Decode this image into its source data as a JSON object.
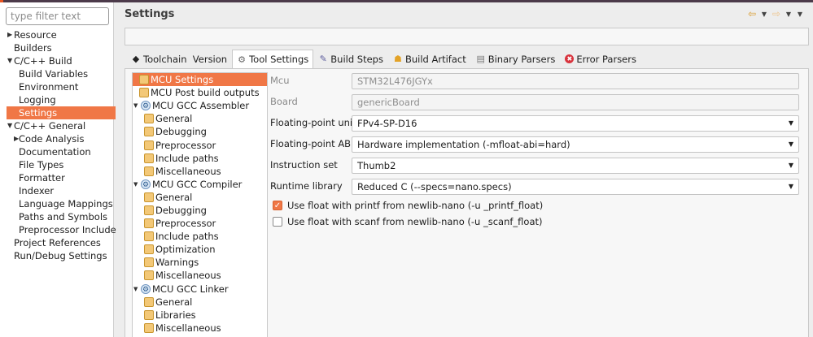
{
  "filter": {
    "placeholder": "type filter text"
  },
  "nav": {
    "items": [
      {
        "label": "Resource",
        "level": 0,
        "arrow": "▶"
      },
      {
        "label": "Builders",
        "level": 0
      },
      {
        "label": "C/C++ Build",
        "level": 0,
        "arrow": "▼"
      },
      {
        "label": "Build Variables",
        "level": 1
      },
      {
        "label": "Environment",
        "level": 1
      },
      {
        "label": "Logging",
        "level": 1
      },
      {
        "label": "Settings",
        "level": 1,
        "selected": true
      },
      {
        "label": "C/C++ General",
        "level": 0,
        "arrow": "▼"
      },
      {
        "label": "Code Analysis",
        "level": 1,
        "arrow": "▶"
      },
      {
        "label": "Documentation",
        "level": 1
      },
      {
        "label": "File Types",
        "level": 1
      },
      {
        "label": "Formatter",
        "level": 1
      },
      {
        "label": "Indexer",
        "level": 1
      },
      {
        "label": "Language Mappings",
        "level": 1
      },
      {
        "label": "Paths and Symbols",
        "level": 1
      },
      {
        "label": "Preprocessor Include",
        "level": 1
      },
      {
        "label": "Project References",
        "level": 0
      },
      {
        "label": "Run/Debug Settings",
        "level": 0
      }
    ]
  },
  "page": {
    "title": "Settings",
    "nav_icons": [
      "back-arrow-icon",
      "dropdown-icon",
      "forward-arrow-icon",
      "dropdown-icon",
      "view-menu-icon"
    ]
  },
  "tabs": [
    {
      "label": "Toolchain  Version",
      "icon": "toolchain-icon",
      "glyph": "◆"
    },
    {
      "label": "Tool Settings",
      "icon": "tool-settings-icon",
      "glyph": "⚙",
      "active": true
    },
    {
      "label": "Build Steps",
      "icon": "build-steps-icon",
      "glyph": "✎"
    },
    {
      "label": "Build Artifact",
      "icon": "build-artifact-icon",
      "glyph": "☗"
    },
    {
      "label": "Binary Parsers",
      "icon": "binary-parsers-icon",
      "glyph": "▤"
    },
    {
      "label": "Error Parsers",
      "icon": "error-parsers-icon",
      "glyph": "✖"
    }
  ],
  "tool_tree": [
    {
      "label": "MCU Settings",
      "type": "folder",
      "depth": 0,
      "selected": true
    },
    {
      "label": "MCU Post build outputs",
      "type": "folder",
      "depth": 0
    },
    {
      "label": "MCU GCC Assembler",
      "type": "tool",
      "depth": 0,
      "expanded": true
    },
    {
      "label": "General",
      "type": "folder",
      "depth": 1
    },
    {
      "label": "Debugging",
      "type": "folder",
      "depth": 1
    },
    {
      "label": "Preprocessor",
      "type": "folder",
      "depth": 1
    },
    {
      "label": "Include paths",
      "type": "folder",
      "depth": 1
    },
    {
      "label": "Miscellaneous",
      "type": "folder",
      "depth": 1
    },
    {
      "label": "MCU GCC Compiler",
      "type": "tool",
      "depth": 0,
      "expanded": true
    },
    {
      "label": "General",
      "type": "folder",
      "depth": 1
    },
    {
      "label": "Debugging",
      "type": "folder",
      "depth": 1
    },
    {
      "label": "Preprocessor",
      "type": "folder",
      "depth": 1
    },
    {
      "label": "Include paths",
      "type": "folder",
      "depth": 1
    },
    {
      "label": "Optimization",
      "type": "folder",
      "depth": 1
    },
    {
      "label": "Warnings",
      "type": "folder",
      "depth": 1
    },
    {
      "label": "Miscellaneous",
      "type": "folder",
      "depth": 1
    },
    {
      "label": "MCU GCC Linker",
      "type": "tool",
      "depth": 0,
      "expanded": true
    },
    {
      "label": "General",
      "type": "folder",
      "depth": 1
    },
    {
      "label": "Libraries",
      "type": "folder",
      "depth": 1
    },
    {
      "label": "Miscellaneous",
      "type": "folder",
      "depth": 1
    }
  ],
  "fields": {
    "mcu": {
      "label": "Mcu",
      "value": "STM32L476JGYx"
    },
    "board": {
      "label": "Board",
      "value": "genericBoard"
    },
    "fpu": {
      "label": "Floating-point unit",
      "value": "FPv4-SP-D16"
    },
    "fpabi": {
      "label": "Floating-point ABI",
      "value": "Hardware implementation (-mfloat-abi=hard)"
    },
    "iset": {
      "label": "Instruction set",
      "value": "Thumb2"
    },
    "runtime": {
      "label": "Runtime library",
      "value": "Reduced C (--specs=nano.specs)"
    }
  },
  "checks": {
    "printf_float": {
      "label": "Use float with printf from newlib-nano (-u _printf_float)",
      "checked": true
    },
    "scanf_float": {
      "label": "Use float with scanf from newlib-nano (-u _scanf_float)",
      "checked": false
    }
  },
  "colors": {
    "selection": "#f07746",
    "window_top": "#4c3a4a",
    "ubuntu_orange": "#e95420"
  }
}
